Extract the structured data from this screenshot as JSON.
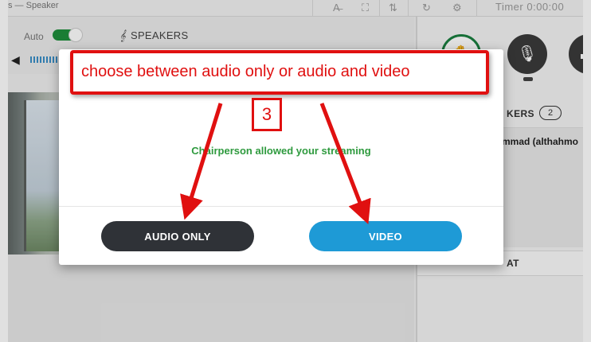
{
  "topbar": {
    "title": "s — Speaker",
    "timer": "Timer 0:00:00"
  },
  "controls": {
    "auto_label": "Auto",
    "speakers_tab": "SPEAKERS"
  },
  "right_panel": {
    "speakers_label": "KERS",
    "speakers_count": "2",
    "speaker_name": "mmad (althahmo",
    "chat_label": "AT"
  },
  "modal": {
    "message": "Chairperson allowed your streaming",
    "audio_button": "AUDIO ONLY",
    "video_button": "VIDEO"
  },
  "annotation": {
    "callout_text": "choose between audio only or audio and video",
    "step_number": "3",
    "color": "#e01010"
  },
  "colors": {
    "accent_blue": "#1e9ad6",
    "dark_button": "#2f3237",
    "success_green": "#2e9a3e",
    "toggle_green": "#1e8f3c"
  },
  "icons": [
    "translate-icon",
    "fullscreen-icon",
    "layout-icon",
    "refresh-icon",
    "settings-icon",
    "microphone-off-icon",
    "raise-hand-icon",
    "microphone-icon",
    "camera-icon",
    "volume-icon"
  ]
}
